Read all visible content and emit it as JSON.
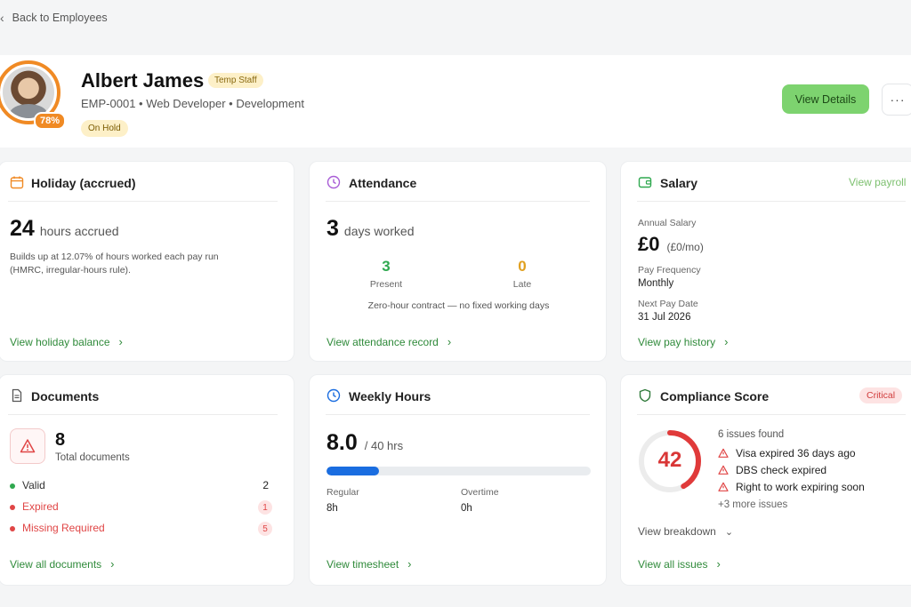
{
  "nav": {
    "back_label": "Back to Employees"
  },
  "employee": {
    "name": "Albert James",
    "type_badge": "Temp Staff",
    "meta": "EMP-0001 • Web Developer • Development",
    "status_badge": "On Hold",
    "profile_completion": "78%",
    "view_details_label": "View Details",
    "more_label": "···"
  },
  "holiday": {
    "title": "Holiday (accrued)",
    "value": "24",
    "unit": "hours accrued",
    "note": "Builds up at 12.07% of hours worked each pay run (HMRC, irregular-hours rule).",
    "link": "View holiday balance"
  },
  "attendance": {
    "title": "Attendance",
    "value": "3",
    "unit": "days worked",
    "present_value": "3",
    "present_label": "Present",
    "late_value": "0",
    "late_label": "Late",
    "note": "Zero-hour contract — no fixed working days",
    "link": "View attendance record"
  },
  "salary": {
    "title": "Salary",
    "header_link": "View payroll",
    "annual_label": "Annual Salary",
    "annual_value": "£0",
    "annual_sub": "(£0/mo)",
    "freq_label": "Pay Frequency",
    "freq_value": "Monthly",
    "next_label": "Next Pay Date",
    "next_value": "31 Jul 2026",
    "link": "View pay history"
  },
  "documents": {
    "title": "Documents",
    "total_value": "8",
    "total_label": "Total documents",
    "rows": [
      {
        "label": "Valid",
        "count": "2",
        "color": "#2fa84f"
      },
      {
        "label": "Expired",
        "count": "1",
        "color": "#e04646"
      },
      {
        "label": "Missing Required",
        "count": "5",
        "color": "#e04646"
      }
    ],
    "link": "View all documents"
  },
  "weekly": {
    "title": "Weekly Hours",
    "value": "8.0",
    "of": "/ 40 hrs",
    "progress": 0.2,
    "regular_label": "Regular",
    "regular_value": "8h",
    "overtime_label": "Overtime",
    "overtime_value": "0h",
    "link": "View timesheet"
  },
  "compliance": {
    "title": "Compliance Score",
    "badge": "Critical",
    "score": "42",
    "score_value": 42,
    "issues_found": "6 issues found",
    "issues": [
      "Visa expired 36 days ago",
      "DBS check expired",
      "Right to work expiring soon"
    ],
    "more": "+3 more issues",
    "breakdown": "View breakdown",
    "link": "View all issues"
  },
  "colors": {
    "accent_green": "#7dd36f",
    "link_green": "#2f8a3a",
    "warning_orange": "#f08a24",
    "danger_red": "#e04646",
    "progress_blue": "#1a6de0"
  }
}
